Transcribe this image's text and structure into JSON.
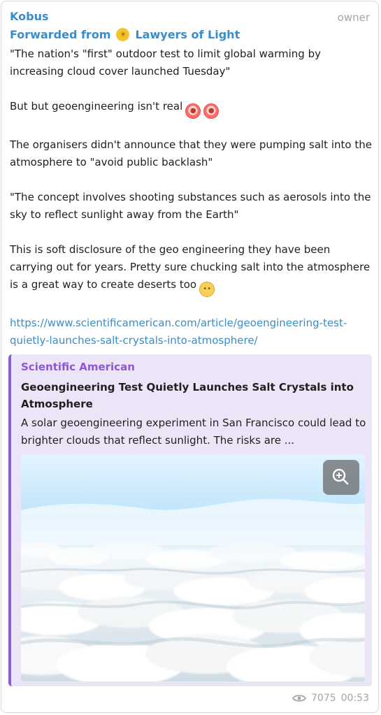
{
  "message": {
    "sender_name": "Kobus",
    "role_badge": "owner",
    "forwarded_from_label": "Forwarded from",
    "forwarded_channel": "Lawyers of Light",
    "paragraph_1": "\"The nation's \"first\" outdoor test to limit global warming by increasing cloud cover launched Tuesday\"",
    "paragraph_2": "But but geoengineering isn't real",
    "paragraph_3": "The organisers didn't announce that they were pumping salt into the atmosphere to \"avoid public backlash\"",
    "paragraph_4": "\"The concept involves shooting substances such as aerosols into the sky to reflect sunlight away from the Earth\"",
    "paragraph_5": "This is soft disclosure of the geo engineering they have been carrying out for years. Pretty sure chucking salt into the atmosphere is a great way to create deserts too",
    "url": "https://www.scientificamerican.com/article/geoengineering-test-quietly-launches-salt-crystals-into-atmosphere/"
  },
  "link_preview": {
    "site_name": "Scientific American",
    "title": "Geoengineering Test Quietly Launches Salt Crystals into Atmosphere",
    "description": "A solar geoengineering experiment in San Francisco could lead to brighter clouds that reflect sunlight. The risks are ..."
  },
  "footer": {
    "views": "7075",
    "time": "00:53"
  },
  "icons": {
    "forwarded_channel_icon": "yellow-channel-avatar-icon",
    "clown_emoji": "clown-face-icon",
    "flushed_emoji": "flushed-face-icon",
    "zoom_icon": "zoom-in-icon",
    "views_icon": "eye-icon"
  },
  "colors": {
    "accent_blue": "#3a8dc8",
    "preview_purple": "#8e56d9",
    "preview_background": "#ebe5f7",
    "muted_gray": "#a5a5a5"
  }
}
